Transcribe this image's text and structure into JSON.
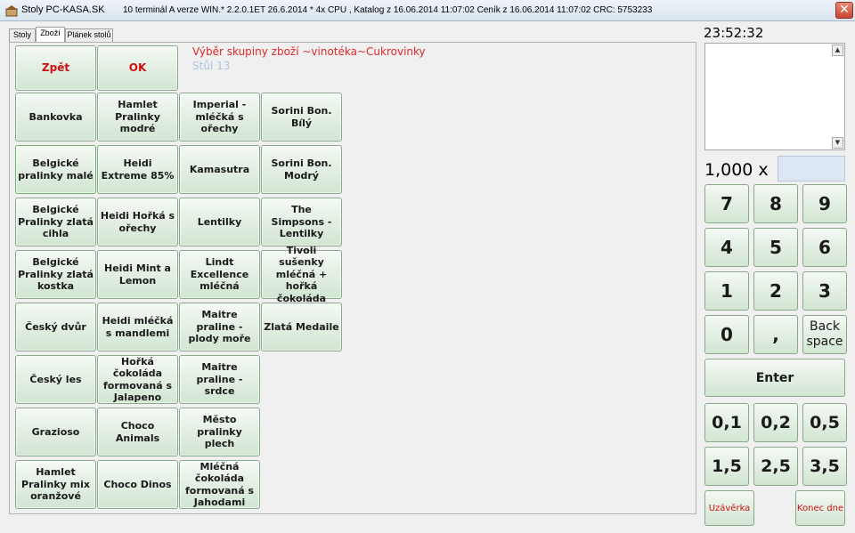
{
  "window": {
    "title": "Stoly PC-KASA.SK",
    "info": "10 terminál A verze WIN.* 2.2.0.1ET 26.6.2014 * 4x CPU , Katalog z 16.06.2014 11:07:02  Ceník z 16.06.2014 11:07:02 CRC: 5753233",
    "close_glyph": "✕"
  },
  "tabs": [
    "Stoly",
    "Zboží",
    "Plánek stolů"
  ],
  "header": {
    "text": "Výběr skupiny zboží ~vinotéka~Cukrovinky",
    "sub": "Stůl 13"
  },
  "actions": {
    "back": "Zpět",
    "ok": "OK"
  },
  "products": [
    [
      "Bankovka",
      "Belgické pralinky malé",
      "Belgické Pralinky zlatá cihla",
      "Belgické Pralinky zlatá kostka",
      "Český dvůr",
      "Český les",
      "Grazioso",
      "Hamlet Pralinky mix oranžové"
    ],
    [
      "Hamlet Pralinky modré",
      "Heidi Extreme 85%",
      "Heidi Hořká s ořechy",
      "Heidi Mint a Lemon",
      "Heidi mléčká s mandlemi",
      "Hořká čokoláda formovaná s Jalapeno",
      "Choco Animals",
      "Choco Dinos"
    ],
    [
      "Imperial - mléčká s ořechy",
      "Kamasutra",
      "Lentilky",
      "Lindt Excellence mléčná",
      "Maitre praline - plody moře",
      "Maitre praline - srdce",
      "Město pralinky plech",
      "Mléčná čokoláda formovaná s Jahodami"
    ],
    [
      "Sorini Bon. Bílý",
      "Sorini Bon. Modrý",
      "The Simpsons - Lentilky",
      "Tivoli sušenky mléčná + hořká čokoláda",
      "Zlatá Medaile"
    ]
  ],
  "right": {
    "clock": "23:52:32",
    "qty": "1,000 x",
    "scroll_up": "▲",
    "scroll_down": "▼",
    "keys": [
      "7",
      "8",
      "9",
      "4",
      "5",
      "6",
      "1",
      "2",
      "3",
      "0",
      ","
    ],
    "backspace": "Back\nspace",
    "enter": "Enter",
    "decimals": [
      "0,1",
      "0,2",
      "0,5",
      "1,5",
      "2,5",
      "3,5"
    ],
    "close_day_report": "Uzávěrka",
    "end_of_day": "Konec dne"
  }
}
